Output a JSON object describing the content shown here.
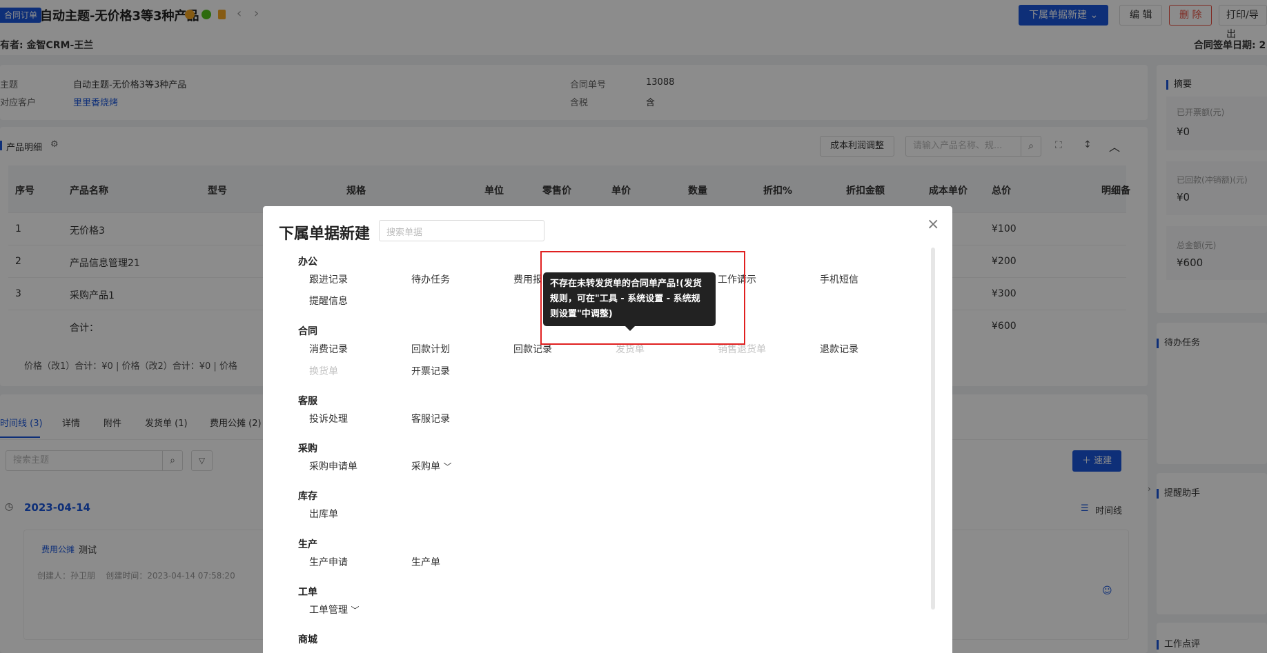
{
  "header": {
    "tag": "合同订单",
    "title": "自动主题-无价格3等3种产品",
    "owner": "有者: 金智CRM-王兰",
    "sign_date": "合同签单日期: 2",
    "btn_new_sub": "下属单据新建",
    "btn_edit": "编 辑",
    "btn_delete": "删 除",
    "btn_print": "打印/导出"
  },
  "info": {
    "subject_label": "主题",
    "subject_value": "自动主题-无价格3等3种产品",
    "customer_label": "对应客户",
    "customer_value": "里里香烧烤",
    "contract_no_label": "合同单号",
    "contract_no_value": "13088",
    "tax_label": "含税",
    "tax_value": "含"
  },
  "products": {
    "section_label": "产品明细",
    "cost_adjust": "成本利润调整",
    "search_placeholder": "请输入产品名称、规...",
    "columns": [
      "序号",
      "产品名称",
      "型号",
      "规格",
      "单位",
      "零售价",
      "单价",
      "数量",
      "折扣%",
      "折扣金额",
      "成本单价",
      "总价",
      "明细备"
    ],
    "rows": [
      {
        "no": "1",
        "name": "无价格3",
        "total": "¥100"
      },
      {
        "no": "2",
        "name": "产品信息管理21",
        "total": "¥200"
      },
      {
        "no": "3",
        "name": "采购产品1",
        "total": "¥300"
      }
    ],
    "sum_label": "合计：",
    "sum_total": "¥600",
    "footer": "价格（改1）合计：¥0 |   价格（改2）合计：¥0 |   价格"
  },
  "tabs": [
    "时间线 (3)",
    "详情",
    "附件",
    "发货单 (1)",
    "费用公摊 (2)"
  ],
  "timeline": {
    "search_placeholder": "搜索主题",
    "quick_build": "速建",
    "date": "2023-04-14",
    "view_label": "时间线",
    "entry_type": "费用公摊",
    "entry_title": "测试",
    "entry_meta": "创建人：孙卫朋    创建时间：2023-04-14 07:58:20"
  },
  "sidebar": {
    "summary_title": "摘要",
    "invoiced_label": "已开票额(元)",
    "invoiced_value": "¥0",
    "received_label": "已回款(冲销额)(元)",
    "received_value": "¥0",
    "total_label": "总金额(元)",
    "total_value": "¥600",
    "todo_title": "待办任务",
    "reminder_title": "提醒助手",
    "review_title": "工作点评"
  },
  "modal": {
    "title": "下属单据新建",
    "search_placeholder": "搜索单据",
    "groups": [
      {
        "name": "办公",
        "items": [
          {
            "label": "跟进记录",
            "disabled": false
          },
          {
            "label": "待办任务",
            "disabled": false
          },
          {
            "label": "费用报",
            "disabled": false
          },
          {
            "label": "工作请示",
            "disabled": false
          },
          {
            "label": "手机短信",
            "disabled": false
          },
          {
            "label": "提醒信息",
            "disabled": false
          }
        ]
      },
      {
        "name": "合同",
        "items": [
          {
            "label": "消费记录",
            "disabled": false
          },
          {
            "label": "回款计划",
            "disabled": false
          },
          {
            "label": "回款记录",
            "disabled": false
          },
          {
            "label": "发货单",
            "disabled": true
          },
          {
            "label": "销售退货单",
            "disabled": true
          },
          {
            "label": "退款记录",
            "disabled": false
          },
          {
            "label": "换货单",
            "disabled": true
          },
          {
            "label": "开票记录",
            "disabled": false
          }
        ]
      },
      {
        "name": "客服",
        "items": [
          {
            "label": "投诉处理",
            "disabled": false
          },
          {
            "label": "客服记录",
            "disabled": false
          }
        ]
      },
      {
        "name": "采购",
        "items": [
          {
            "label": "采购申请单",
            "disabled": false
          },
          {
            "label": "采购单",
            "disabled": false
          }
        ]
      },
      {
        "name": "库存",
        "items": [
          {
            "label": "出库单",
            "disabled": false
          }
        ]
      },
      {
        "name": "生产",
        "items": [
          {
            "label": "生产申请",
            "disabled": false
          },
          {
            "label": "生产单",
            "disabled": false
          }
        ]
      },
      {
        "name": "工单",
        "items": [
          {
            "label": "工单管理",
            "disabled": false
          }
        ]
      },
      {
        "name": "商城",
        "items": []
      }
    ],
    "tooltip": "不存在未转发货单的合同单产品!(发货规则，可在\"工具 - 系统设置 - 系统规则设置\"中调整)"
  },
  "colors": {
    "primary": "#1a56db",
    "danger": "#e74c3c",
    "highlight_box": "#e02020",
    "tooltip_bg": "#222222"
  }
}
